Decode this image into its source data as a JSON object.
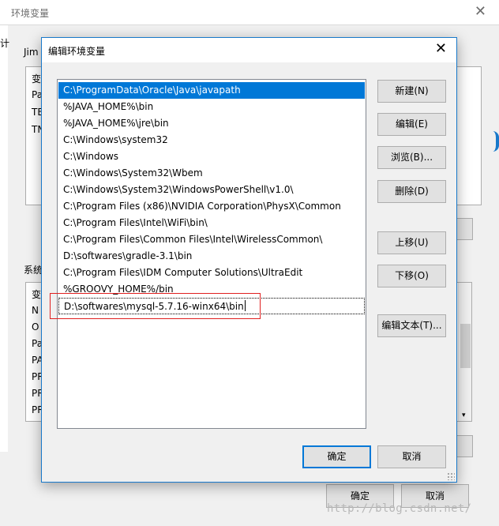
{
  "outer": {
    "title": "环境变量",
    "close_glyph": "✕",
    "left_strip_char": "计",
    "user_group_label": "Jim",
    "user_header": "变",
    "user_rows": [
      "Pa",
      "TE",
      "TN"
    ],
    "sys_group_label": "系统",
    "sys_header": "变",
    "sys_rows": [
      "N",
      "O",
      "Pa",
      "PA",
      "PR",
      "PR",
      "PR"
    ],
    "ok_label": "确定",
    "cancel_label": "取消",
    "watermark": "http://blog.csdn.net/"
  },
  "dialog": {
    "title": "编辑环境变量",
    "close_glyph": "✕",
    "paths": [
      "C:\\ProgramData\\Oracle\\Java\\javapath",
      "%JAVA_HOME%\\bin",
      "%JAVA_HOME%\\jre\\bin",
      "C:\\Windows\\system32",
      "C:\\Windows",
      "C:\\Windows\\System32\\Wbem",
      "C:\\Windows\\System32\\WindowsPowerShell\\v1.0\\",
      "C:\\Program Files (x86)\\NVIDIA Corporation\\PhysX\\Common",
      "C:\\Program Files\\Intel\\WiFi\\bin\\",
      "C:\\Program Files\\Common Files\\Intel\\WirelessCommon\\",
      "D:\\softwares\\gradle-3.1\\bin",
      "C:\\Program Files\\IDM Computer Solutions\\UltraEdit",
      "%GROOVY_HOME%/bin",
      "D:\\softwares\\mysql-5.7.16-winx64\\bin"
    ],
    "buttons": {
      "new": "新建(N)",
      "edit": "编辑(E)",
      "browse": "浏览(B)...",
      "delete": "删除(D)",
      "move_up": "上移(U)",
      "move_down": "下移(O)",
      "edit_text": "编辑文本(T)..."
    },
    "ok_label": "确定",
    "cancel_label": "取消"
  },
  "colors": {
    "selection": "#0078d7",
    "highlight_box": "#e02020",
    "window_border": "#1979ca"
  }
}
